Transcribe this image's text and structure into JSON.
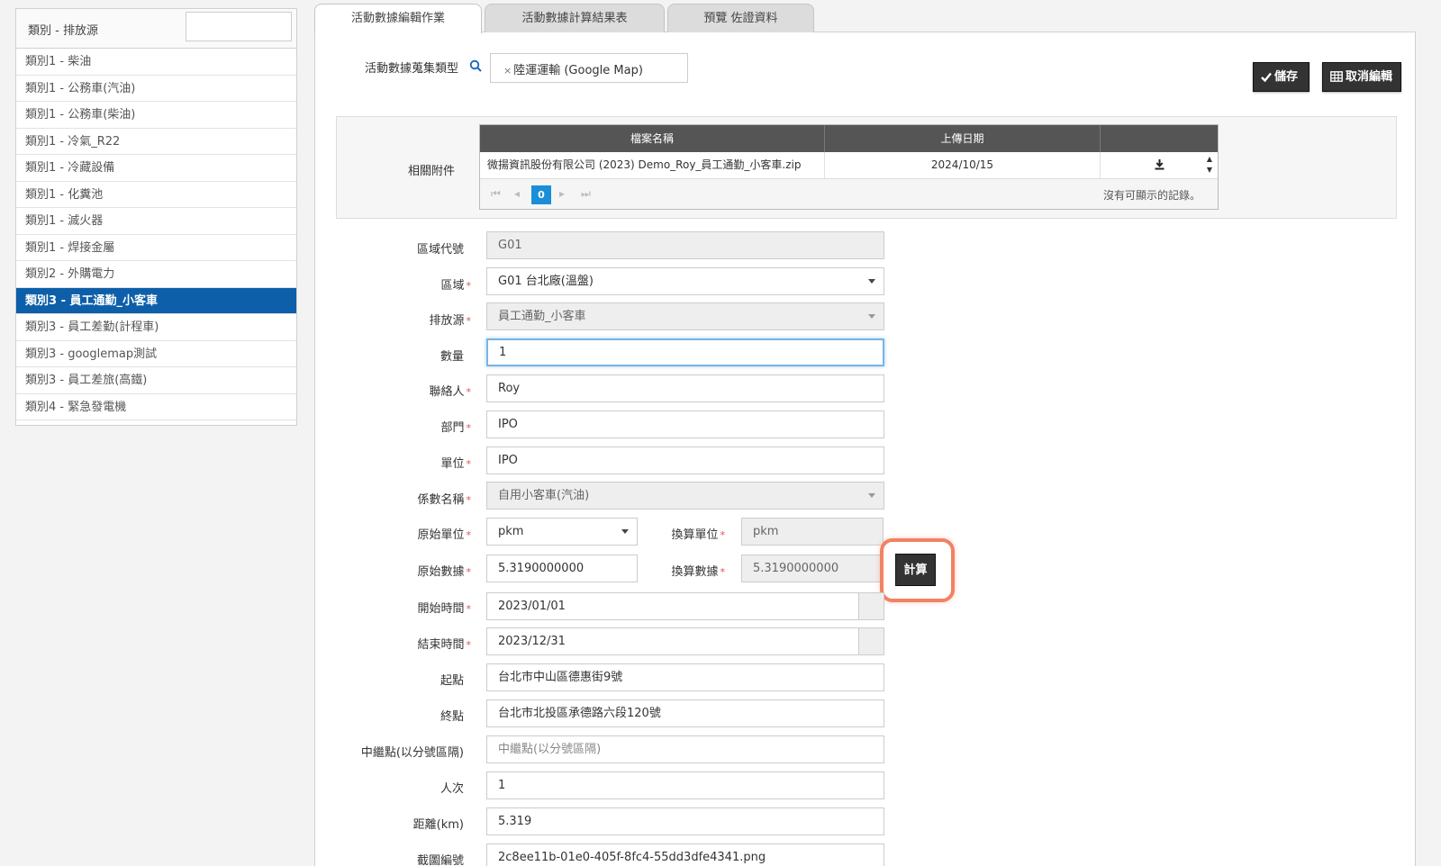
{
  "sidebar": {
    "title": "類別 - 排放源",
    "search_value": "",
    "items": [
      {
        "label": "類別1 - 柴油"
      },
      {
        "label": "類別1 - 公務車(汽油)"
      },
      {
        "label": "類別1 - 公務車(柴油)"
      },
      {
        "label": "類別1 - 冷氣_R22"
      },
      {
        "label": "類別1 - 冷藏設備"
      },
      {
        "label": "類別1 - 化糞池"
      },
      {
        "label": "類別1 - 滅火器"
      },
      {
        "label": "類別1 - 焊接金屬"
      },
      {
        "label": "類別2 - 外購電力"
      },
      {
        "label": "類別3 - 員工通勤_小客車"
      },
      {
        "label": "類別3 - 員工差勤(計程車)"
      },
      {
        "label": "類別3 - googlemap測試"
      },
      {
        "label": "類別3 - 員工差旅(高鐵)"
      },
      {
        "label": "類別4 - 緊急發電機"
      }
    ],
    "active_index": 9
  },
  "tabs": [
    {
      "label": "活動數據編輯作業"
    },
    {
      "label": "活動數據計算結果表"
    },
    {
      "label": "預覽 佐證資料"
    }
  ],
  "collect": {
    "label": "活動數據蒐集類型",
    "remove_symbol": "×",
    "value": "陸運運輸 (Google Map)"
  },
  "toolbar": {
    "save_label": "儲存",
    "cancel_label": "取消編輯"
  },
  "attachments": {
    "label": "相關附件",
    "columns": [
      "檔案名稱",
      "上傳日期",
      ""
    ],
    "rows": [
      {
        "file": "微揚資訊股份有限公司 (2023) Demo_Roy_員工通勤_小客車.zip",
        "date": "2024/10/15"
      }
    ],
    "pager": {
      "current": "0",
      "empty_text": "沒有可顯示的記錄。"
    }
  },
  "form": {
    "area_code": {
      "label": "區域代號",
      "value": "G01"
    },
    "area": {
      "label": "區域",
      "value": "G01 台北廠(溫盤)"
    },
    "source": {
      "label": "排放源",
      "value": "員工通勤_小客車"
    },
    "quantity": {
      "label": "數量",
      "value": "1"
    },
    "contact": {
      "label": "聯絡人",
      "value": "Roy"
    },
    "department": {
      "label": "部門",
      "value": "IPO"
    },
    "unit": {
      "label": "單位",
      "value": "IPO"
    },
    "factor": {
      "label": "係數名稱",
      "value": "自用小客車(汽油)"
    },
    "orig_unit": {
      "label": "原始單位",
      "value": "pkm"
    },
    "conv_unit": {
      "label": "換算單位",
      "value": "pkm"
    },
    "orig_data": {
      "label": "原始數據",
      "value": "5.3190000000"
    },
    "conv_data": {
      "label": "換算數據",
      "value": "5.3190000000"
    },
    "calc_label": "計算",
    "start": {
      "label": "開始時間",
      "value": "2023/01/01"
    },
    "end": {
      "label": "結束時間",
      "value": "2023/12/31"
    },
    "origin": {
      "label": "起點",
      "value": "台北市中山區德惠街9號"
    },
    "destination": {
      "label": "終點",
      "value": "台北市北投區承德路六段120號"
    },
    "waypoints": {
      "label": "中繼點(以分號區隔)",
      "placeholder": "中繼點(以分號區隔)"
    },
    "people": {
      "label": "人次",
      "value": "1"
    },
    "distance": {
      "label": "距離(km)",
      "value": "5.319"
    },
    "screenshot": {
      "label": "截圖編號",
      "value": "2c8ee11b-01e0-405f-8fc4-55dd3dfe4341.png"
    }
  }
}
